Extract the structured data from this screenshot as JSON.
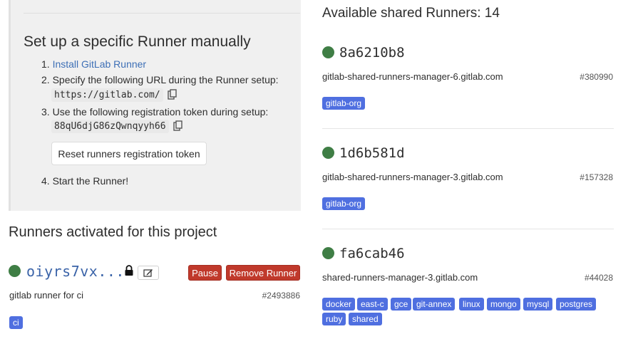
{
  "setup": {
    "title": "Set up a specific Runner manually",
    "step1_link": "Install GitLab Runner",
    "step2_text": "Specify the following URL during the Runner setup:",
    "url": "https://gitlab.com/",
    "step3_text": "Use the following registration token during setup:",
    "token": "88qU6djG86zQwnqyyh66",
    "reset_button": "Reset runners registration token",
    "step4_text": "Start the Runner!",
    "step_numbers": [
      "1.",
      "2.",
      "3.",
      "4."
    ]
  },
  "activated": {
    "title": "Runners activated for this project",
    "runner": {
      "name": "oiyrs7vx...",
      "pause_label": "Pause",
      "remove_label": "Remove Runner",
      "description": "gitlab runner for ci",
      "id": "#2493886",
      "tags": [
        "ci"
      ],
      "status_color": "#3f7e45"
    }
  },
  "shared": {
    "title": "Available shared Runners: 14",
    "runners": [
      {
        "name": "8a6210b8",
        "description": "gitlab-shared-runners-manager-6.gitlab.com",
        "id": "#380990",
        "tags": [
          "gitlab-org"
        ]
      },
      {
        "name": "1d6b581d",
        "description": "gitlab-shared-runners-manager-3.gitlab.com",
        "id": "#157328",
        "tags": [
          "gitlab-org"
        ]
      },
      {
        "name": "fa6cab46",
        "description": "shared-runners-manager-3.gitlab.com",
        "id": "#44028",
        "tags": [
          "docker",
          "east-c",
          "gce",
          "git-annex",
          "linux",
          "mongo",
          "mysql",
          "postgres",
          "ruby",
          "shared"
        ]
      }
    ]
  },
  "colors": {
    "tag_bg": "#4f6fe0",
    "danger": "#c0392b",
    "online": "#3f7e45",
    "link": "#3d6fb6"
  }
}
